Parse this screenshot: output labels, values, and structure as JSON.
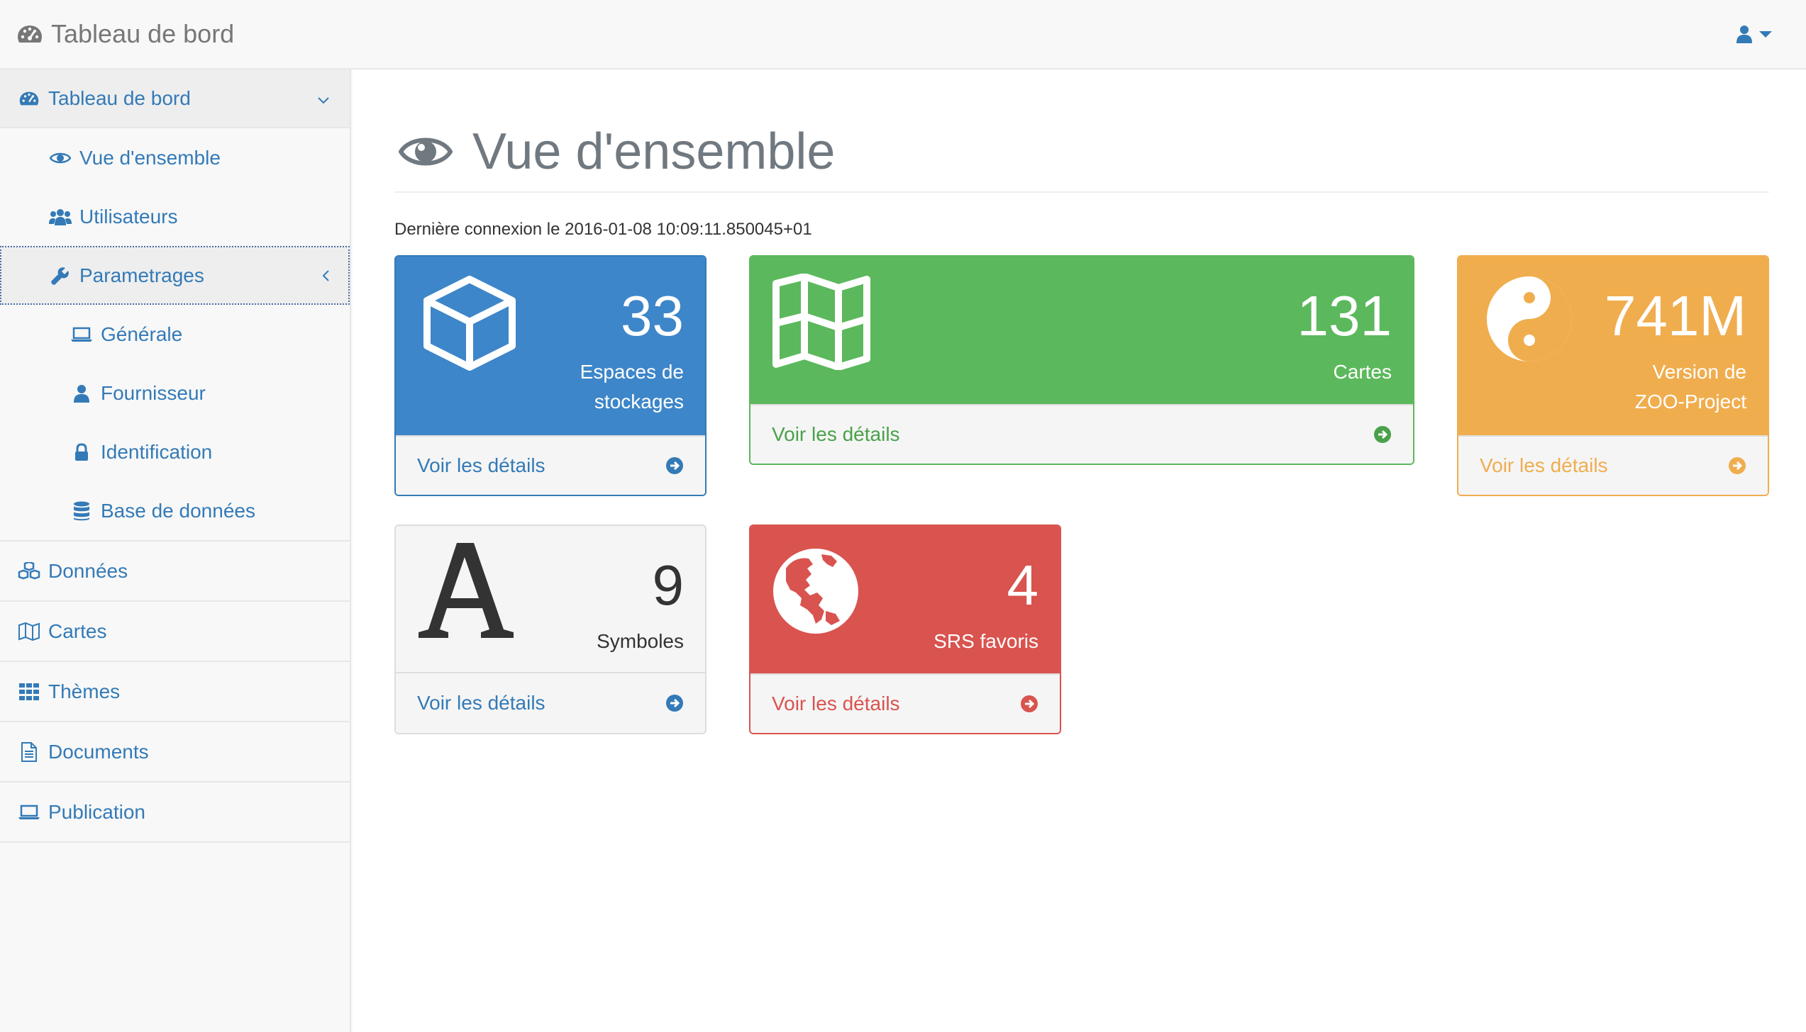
{
  "navbar": {
    "brand": "Tableau de bord"
  },
  "sidebar": {
    "dashboard": "Tableau de bord",
    "overview": "Vue d'ensemble",
    "users": "Utilisateurs",
    "settings": "Parametrages",
    "general": "Générale",
    "provider": "Fournisseur",
    "identification": "Identification",
    "database": "Base de données",
    "data": "Données",
    "maps": "Cartes",
    "themes": "Thèmes",
    "documents": "Documents",
    "publication": "Publication"
  },
  "main": {
    "title": "Vue d'ensemble",
    "last_login": "Dernière connexion le 2016-01-08 10:09:11.850045+01",
    "details_label": "Voir les détails",
    "panels": [
      {
        "value": "33",
        "label_line1": "Espaces de",
        "label_line2": "stockages",
        "color": "#337ab7",
        "icon": "cube-icon"
      },
      {
        "value": "131",
        "label_line1": "Cartes",
        "color": "#5cb85c",
        "icon": "map-icon"
      },
      {
        "value": "741M",
        "label_line1": "Version de",
        "label_line2": "ZOO-Project",
        "color": "#f0ad4e",
        "icon": "yin-yang-icon"
      },
      {
        "value": "9",
        "label_line1": "Symboles",
        "color": "#f5f5f5",
        "icon": "font-icon"
      },
      {
        "value": "4",
        "label_line1": "SRS favoris",
        "color": "#d9534f",
        "icon": "globe-icon"
      }
    ]
  },
  "colors": {
    "primary": "#337ab7",
    "success": "#5cb85c",
    "warning": "#f0ad4e",
    "danger": "#d9534f"
  }
}
